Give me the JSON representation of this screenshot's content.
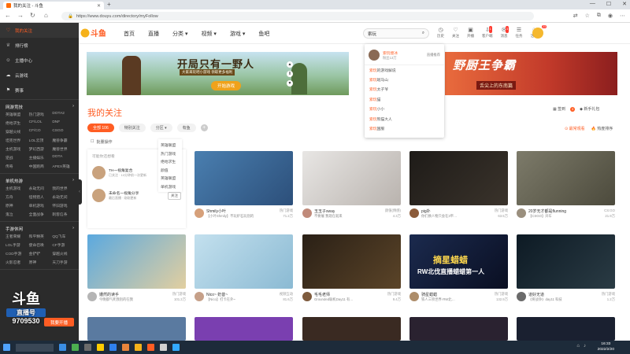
{
  "browser": {
    "tab_title": "我的关注 - 斗鱼",
    "new_tab": "+",
    "url": "https://www.douyu.com/directory/myFollow",
    "win_min": "—",
    "win_max": "☐",
    "win_close": "✕"
  },
  "sidebar": {
    "items": [
      {
        "label": "我的关注",
        "icon": "heart-icon",
        "active": true
      },
      {
        "label": "排行榜",
        "icon": "trophy-icon"
      },
      {
        "label": "主播中心",
        "icon": "user-icon"
      },
      {
        "label": "云游戏",
        "icon": "cloud-icon"
      },
      {
        "label": "赛事",
        "icon": "flag-icon"
      }
    ],
    "sections": [
      {
        "title": "网游竞技",
        "more": "›",
        "cells": [
          "英雄联盟",
          "热门游戏",
          "DOTA2",
          "绝地求生",
          "CF/LOL",
          "DNF",
          "穿越火线",
          "CF/CO",
          "CSGO",
          "坦克世界",
          "LOL云顶",
          "魔兽争霸",
          "主机游戏",
          "梦幻西游",
          "魔兽世界",
          "逆战",
          "主播娱乐",
          "DOTA",
          "传奇",
          "中国跑商",
          "APEX英雄"
        ]
      },
      {
        "title": "单机热游",
        "more": "›",
        "cells": [
          "主机游戏",
          "永劫无间",
          "我的世界",
          "方舟",
          "怪物猎人",
          "永劫无间",
          "原神",
          "单机游戏",
          "怀旧游戏",
          "鬼泣",
          "全面战争",
          "刺客信条"
        ]
      },
      {
        "title": "手游休闲",
        "more": "›",
        "cells": [
          "王者荣耀",
          "和平精英",
          "QQ飞车",
          "LOL手游",
          "使命召唤",
          "CF手游",
          "COD手游",
          "金铲铲",
          "穿越火线",
          "火影忍者",
          "原神",
          "天刀手游"
        ]
      }
    ],
    "overlay_brand": "斗鱼",
    "overlay_sub": "直播号",
    "overlay_room": "9709530",
    "live_button": "我要开播"
  },
  "header": {
    "logo": "斗鱼",
    "nav": [
      "首页",
      "直播",
      "分类 ▾",
      "视频 ▾",
      "游戏 ▾",
      "鱼吧"
    ],
    "search_query": "索玩",
    "icons": [
      {
        "label": "历史",
        "icon": "clock-icon"
      },
      {
        "label": "关注",
        "icon": "heart-icon"
      },
      {
        "label": "开播",
        "icon": "camera-icon"
      },
      {
        "label": "客户端",
        "icon": "download-icon",
        "badge": "1"
      },
      {
        "label": "消息",
        "icon": "bell-icon",
        "badge": "3"
      },
      {
        "label": "任务",
        "icon": "task-icon"
      },
      {
        "label": "活动",
        "icon": "gift-icon"
      }
    ],
    "avatar_badge": "23"
  },
  "banners": {
    "left_title": "开局只有一野人",
    "left_sub": "大家来玩吧小游戏 领取更多福利",
    "left_cta": "开始游戏",
    "right_title": "野厨王争霸",
    "right_sub": "舌尖上的东南篇"
  },
  "dropdown": {
    "user_name": "索玩傻冰",
    "user_fans": "粉丝13万",
    "user_tag": "直播推荐",
    "keyword": "索玩",
    "suggestions": [
      "的游戏解说",
      "斑马山",
      "太子爷",
      "猫",
      "小小",
      "熊猫大人",
      "国服"
    ]
  },
  "page": {
    "title": "我的关注",
    "right_links": [
      "签到",
      "新手礼包"
    ],
    "right_badge": "3",
    "filters": [
      {
        "label": "全部  106",
        "active": true
      },
      {
        "label": "特别关注",
        "active": false
      },
      {
        "label": "分区 ▾",
        "active": false
      },
      {
        "label": "有鱼",
        "active": false
      }
    ],
    "add": "+",
    "tools": [
      "最常观看",
      "热度排序"
    ],
    "manage": "批量操作",
    "rec_title": "可能你还想看",
    "recs": [
      {
        "name": "TH一视角复合",
        "desc": "已关注 · 10分钟前一次更新",
        "btn": "关注"
      },
      {
        "name": "未命名一视角分享",
        "desc": "最后直播 · 刚刚更新",
        "btn": "关注"
      }
    ],
    "categories": [
      "英雄联盟",
      "热门游戏",
      "绝地求生",
      "颜值",
      "英雄联盟",
      "单机游戏"
    ]
  },
  "cards": [
    {
      "name": "Shmily小叶",
      "cat": "热门游戏",
      "title": "【小叶Shmily】不玩炉石玩别的",
      "hot": "71.2万",
      "colors": [
        "#4a7fb0",
        "#2c4f7a"
      ],
      "av": "#d6a07a"
    },
    {
      "name": "玉玉子sway",
      "cat": "颜值(情感)",
      "title": "不要催 我现在就来",
      "hot": "4.3万",
      "colors": [
        "#e8e6e4",
        "#b9b3ae"
      ],
      "av": "#c08a7a"
    },
    {
      "name": "pig扑",
      "cat": "热门游戏",
      "title": "你们换人物只会在3平…",
      "hot": "63.5万",
      "colors": [
        "#1e1b18",
        "#3a332b"
      ],
      "av": "#8b5b3a"
    },
    {
      "name": "20岁无才都是flunning",
      "cat": "CS:GO",
      "title": "【CSGO】开车",
      "hot": "21.9万",
      "colors": [
        "#7d7b6a",
        "#4c4a3c"
      ],
      "av": "#9a8f7e"
    },
    {
      "name": "姗然的读手",
      "cat": "热门游戏",
      "title": "今晚都气死我别的在我",
      "hot": "101.2万",
      "colors": [
        "#5ba9df",
        "#e2cfa0"
      ],
      "av": "#b5b5b5"
    },
    {
      "name": "Nico~ 奶昔~",
      "cat": "视频互动",
      "title": "【Nico】打卡在外~",
      "hot": "81.6万",
      "colors": [
        "#c3e0ee",
        "#8bbad3"
      ],
      "av": "#c6a089"
    },
    {
      "name": "毛毛老师",
      "cat": "热门游戏",
      "title": "Grounded联机Day11 有…",
      "hot": "9.4万",
      "colors": [
        "#2a2016",
        "#5b4428"
      ],
      "av": "#7e5b3d"
    },
    {
      "name": "骑星蜡蜡",
      "cat": "热门游戏",
      "title": "铁人三项世界·RW北…",
      "hot": "132.9万",
      "colors": [
        "#1b2a4e",
        "#0a0f22"
      ],
      "av": "#ad8d6a"
    },
    {
      "name": "道好无道",
      "cat": "热门游戏",
      "title": "《将战争》day11 科技",
      "hot": "1.2万",
      "colors": [
        "#0d1a24",
        "#2a3b44"
      ],
      "av": "#6a6a6a"
    }
  ],
  "overlay_banner_left": "摘星蜡蜡",
  "overlay_banner_right": "RW北伐直播蜡蜡第一人",
  "taskbar": {
    "time": "16:33",
    "date": "2022/2/20"
  },
  "colors": {
    "accent": "#ff5d23",
    "sidebar": "#2b2b2b"
  }
}
